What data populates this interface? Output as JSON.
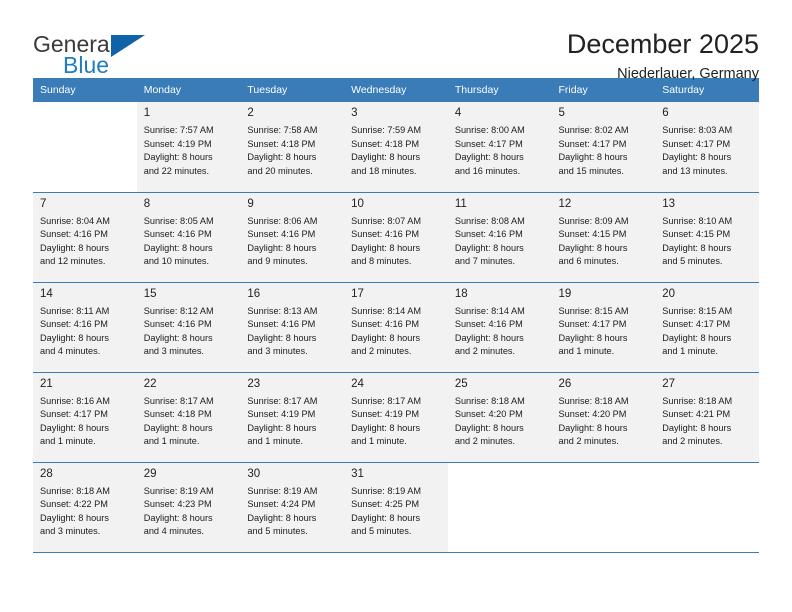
{
  "brand": {
    "name_top": "General",
    "name_bottom": "Blue",
    "triangle_icon": "blue-triangle-logo-mark",
    "color_top": "#3b3b3b",
    "color_bottom": "#1f7ec2",
    "color_triangle": "#0f63a8"
  },
  "header": {
    "title": "December 2025",
    "subtitle": "Niederlauer, Germany",
    "accent_color": "#3a7cb8"
  },
  "weekdays": [
    "Sunday",
    "Monday",
    "Tuesday",
    "Wednesday",
    "Thursday",
    "Friday",
    "Saturday"
  ],
  "weeks": [
    [
      {
        "day": "",
        "detail": "",
        "empty": true
      },
      {
        "day": "1",
        "detail": "Sunrise: 7:57 AM\nSunset: 4:19 PM\nDaylight: 8 hours\nand 22 minutes."
      },
      {
        "day": "2",
        "detail": "Sunrise: 7:58 AM\nSunset: 4:18 PM\nDaylight: 8 hours\nand 20 minutes."
      },
      {
        "day": "3",
        "detail": "Sunrise: 7:59 AM\nSunset: 4:18 PM\nDaylight: 8 hours\nand 18 minutes."
      },
      {
        "day": "4",
        "detail": "Sunrise: 8:00 AM\nSunset: 4:17 PM\nDaylight: 8 hours\nand 16 minutes."
      },
      {
        "day": "5",
        "detail": "Sunrise: 8:02 AM\nSunset: 4:17 PM\nDaylight: 8 hours\nand 15 minutes."
      },
      {
        "day": "6",
        "detail": "Sunrise: 8:03 AM\nSunset: 4:17 PM\nDaylight: 8 hours\nand 13 minutes."
      }
    ],
    [
      {
        "day": "7",
        "detail": "Sunrise: 8:04 AM\nSunset: 4:16 PM\nDaylight: 8 hours\nand 12 minutes."
      },
      {
        "day": "8",
        "detail": "Sunrise: 8:05 AM\nSunset: 4:16 PM\nDaylight: 8 hours\nand 10 minutes."
      },
      {
        "day": "9",
        "detail": "Sunrise: 8:06 AM\nSunset: 4:16 PM\nDaylight: 8 hours\nand 9 minutes."
      },
      {
        "day": "10",
        "detail": "Sunrise: 8:07 AM\nSunset: 4:16 PM\nDaylight: 8 hours\nand 8 minutes."
      },
      {
        "day": "11",
        "detail": "Sunrise: 8:08 AM\nSunset: 4:16 PM\nDaylight: 8 hours\nand 7 minutes."
      },
      {
        "day": "12",
        "detail": "Sunrise: 8:09 AM\nSunset: 4:15 PM\nDaylight: 8 hours\nand 6 minutes."
      },
      {
        "day": "13",
        "detail": "Sunrise: 8:10 AM\nSunset: 4:15 PM\nDaylight: 8 hours\nand 5 minutes."
      }
    ],
    [
      {
        "day": "14",
        "detail": "Sunrise: 8:11 AM\nSunset: 4:16 PM\nDaylight: 8 hours\nand 4 minutes."
      },
      {
        "day": "15",
        "detail": "Sunrise: 8:12 AM\nSunset: 4:16 PM\nDaylight: 8 hours\nand 3 minutes."
      },
      {
        "day": "16",
        "detail": "Sunrise: 8:13 AM\nSunset: 4:16 PM\nDaylight: 8 hours\nand 3 minutes."
      },
      {
        "day": "17",
        "detail": "Sunrise: 8:14 AM\nSunset: 4:16 PM\nDaylight: 8 hours\nand 2 minutes."
      },
      {
        "day": "18",
        "detail": "Sunrise: 8:14 AM\nSunset: 4:16 PM\nDaylight: 8 hours\nand 2 minutes."
      },
      {
        "day": "19",
        "detail": "Sunrise: 8:15 AM\nSunset: 4:17 PM\nDaylight: 8 hours\nand 1 minute."
      },
      {
        "day": "20",
        "detail": "Sunrise: 8:15 AM\nSunset: 4:17 PM\nDaylight: 8 hours\nand 1 minute."
      }
    ],
    [
      {
        "day": "21",
        "detail": "Sunrise: 8:16 AM\nSunset: 4:17 PM\nDaylight: 8 hours\nand 1 minute."
      },
      {
        "day": "22",
        "detail": "Sunrise: 8:17 AM\nSunset: 4:18 PM\nDaylight: 8 hours\nand 1 minute."
      },
      {
        "day": "23",
        "detail": "Sunrise: 8:17 AM\nSunset: 4:19 PM\nDaylight: 8 hours\nand 1 minute."
      },
      {
        "day": "24",
        "detail": "Sunrise: 8:17 AM\nSunset: 4:19 PM\nDaylight: 8 hours\nand 1 minute."
      },
      {
        "day": "25",
        "detail": "Sunrise: 8:18 AM\nSunset: 4:20 PM\nDaylight: 8 hours\nand 2 minutes."
      },
      {
        "day": "26",
        "detail": "Sunrise: 8:18 AM\nSunset: 4:20 PM\nDaylight: 8 hours\nand 2 minutes."
      },
      {
        "day": "27",
        "detail": "Sunrise: 8:18 AM\nSunset: 4:21 PM\nDaylight: 8 hours\nand 2 minutes."
      }
    ],
    [
      {
        "day": "28",
        "detail": "Sunrise: 8:18 AM\nSunset: 4:22 PM\nDaylight: 8 hours\nand 3 minutes."
      },
      {
        "day": "29",
        "detail": "Sunrise: 8:19 AM\nSunset: 4:23 PM\nDaylight: 8 hours\nand 4 minutes."
      },
      {
        "day": "30",
        "detail": "Sunrise: 8:19 AM\nSunset: 4:24 PM\nDaylight: 8 hours\nand 5 minutes."
      },
      {
        "day": "31",
        "detail": "Sunrise: 8:19 AM\nSunset: 4:25 PM\nDaylight: 8 hours\nand 5 minutes."
      },
      {
        "day": "",
        "detail": "",
        "empty": true
      },
      {
        "day": "",
        "detail": "",
        "empty": true
      },
      {
        "day": "",
        "detail": "",
        "empty": true
      }
    ]
  ]
}
